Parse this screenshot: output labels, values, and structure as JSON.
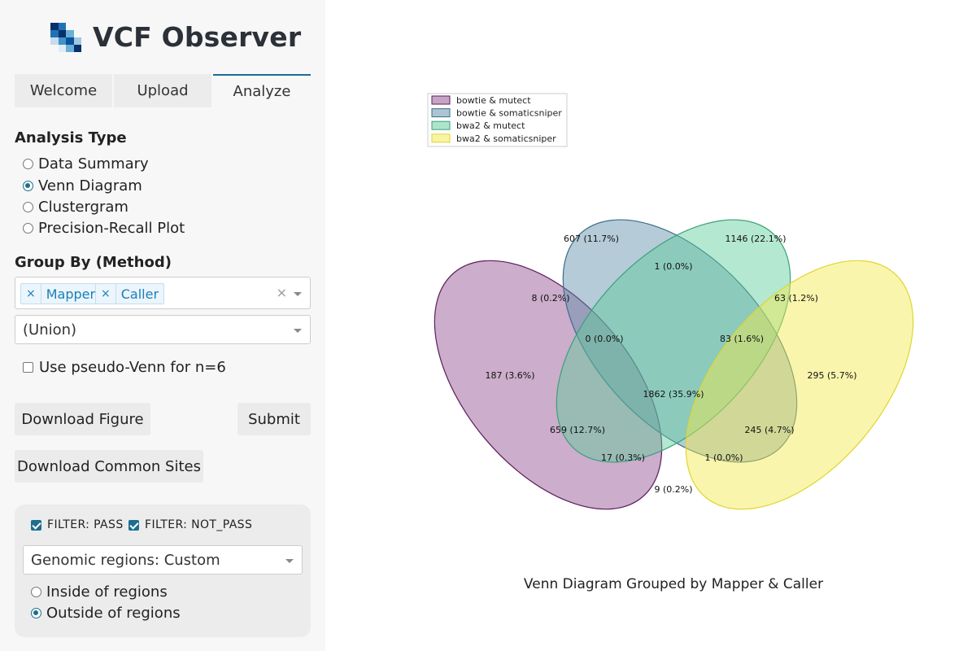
{
  "app": {
    "title": "VCF Observer",
    "logo_colors": [
      "#08306b",
      "#2171b5",
      "#6baed6",
      "#c6dbef",
      "#4292c6",
      "#08519c",
      "#9ecae1",
      "#deebf7"
    ]
  },
  "tabs": [
    {
      "label": "Welcome",
      "active": false
    },
    {
      "label": "Upload",
      "active": false
    },
    {
      "label": "Analyze",
      "active": true
    }
  ],
  "analysis": {
    "title": "Analysis Type",
    "options": [
      {
        "label": "Data Summary",
        "selected": false
      },
      {
        "label": "Venn Diagram",
        "selected": true
      },
      {
        "label": "Clustergram",
        "selected": false
      },
      {
        "label": "Precision-Recall Plot",
        "selected": false
      }
    ]
  },
  "group_by": {
    "title": "Group By (Method)",
    "chips": [
      {
        "remove": "×",
        "label": "Mapper"
      },
      {
        "remove": "×",
        "label": "Caller"
      }
    ],
    "clear": "×",
    "set_operation": "(Union)",
    "pseudo_venn_label": "Use pseudo-Venn for n=6",
    "pseudo_venn_checked": false
  },
  "buttons": {
    "download_figure": "Download Figure",
    "submit": "Submit",
    "download_common": "Download Common Sites"
  },
  "filters": {
    "pass_label": "FILTER: PASS",
    "pass_checked": true,
    "not_pass_label": "FILTER: NOT_PASS",
    "not_pass_checked": true,
    "regions_select": "Genomic regions: Custom",
    "region_options": [
      {
        "label": "Inside of regions",
        "selected": false
      },
      {
        "label": "Outside of regions",
        "selected": true
      }
    ]
  },
  "colors": {
    "accent": "#1d6f8f"
  },
  "chart_data": {
    "type": "venn",
    "title": "Venn Diagram Grouped by Mapper & Caller",
    "legend_position": "top-left",
    "sets": [
      {
        "name": "bowtie & mutect",
        "color": "#8e4a8c",
        "edge": "#5a1f5c"
      },
      {
        "name": "bowtie & somaticsniper",
        "color": "#5c8ba7",
        "edge": "#3b6d8a"
      },
      {
        "name": "bwa2 & mutect",
        "color": "#5ccb9a",
        "edge": "#3aa07a"
      },
      {
        "name": "bwa2 & somaticsniper",
        "color": "#f4e84a",
        "edge": "#e0d630"
      }
    ],
    "regions": [
      {
        "label": "607 (11.7%)",
        "value": 607,
        "percent": 11.7
      },
      {
        "label": "1146 (22.1%)",
        "value": 1146,
        "percent": 22.1
      },
      {
        "label": "1 (0.0%)",
        "value": 1,
        "percent": 0.0
      },
      {
        "label": "8 (0.2%)",
        "value": 8,
        "percent": 0.2
      },
      {
        "label": "63 (1.2%)",
        "value": 63,
        "percent": 1.2
      },
      {
        "label": "0 (0.0%)",
        "value": 0,
        "percent": 0.0
      },
      {
        "label": "83 (1.6%)",
        "value": 83,
        "percent": 1.6
      },
      {
        "label": "187 (3.6%)",
        "value": 187,
        "percent": 3.6
      },
      {
        "label": "295 (5.7%)",
        "value": 295,
        "percent": 5.7
      },
      {
        "label": "1862 (35.9%)",
        "value": 1862,
        "percent": 35.9
      },
      {
        "label": "659 (12.7%)",
        "value": 659,
        "percent": 12.7
      },
      {
        "label": "245 (4.7%)",
        "value": 245,
        "percent": 4.7
      },
      {
        "label": "17 (0.3%)",
        "value": 17,
        "percent": 0.3
      },
      {
        "label": "1 (0.0%)",
        "value": 1,
        "percent": 0.0
      },
      {
        "label": "9 (0.2%)",
        "value": 9,
        "percent": 0.2
      }
    ]
  }
}
